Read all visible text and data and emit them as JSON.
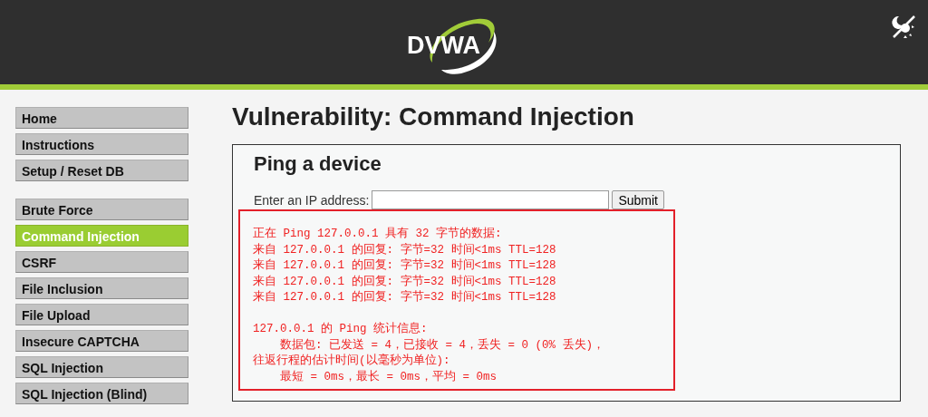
{
  "header": {
    "logo": "DVWA"
  },
  "sidebar": {
    "groups": [
      [
        {
          "label": "Home",
          "selected": false
        },
        {
          "label": "Instructions",
          "selected": false
        },
        {
          "label": "Setup / Reset DB",
          "selected": false
        }
      ],
      [
        {
          "label": "Brute Force",
          "selected": false
        },
        {
          "label": "Command Injection",
          "selected": true
        },
        {
          "label": "CSRF",
          "selected": false
        },
        {
          "label": "File Inclusion",
          "selected": false
        },
        {
          "label": "File Upload",
          "selected": false
        },
        {
          "label": "Insecure CAPTCHA",
          "selected": false
        },
        {
          "label": "SQL Injection",
          "selected": false
        },
        {
          "label": "SQL Injection (Blind)",
          "selected": false
        }
      ]
    ]
  },
  "main": {
    "title": "Vulnerability: Command Injection",
    "panel_title": "Ping a device",
    "form": {
      "label": "Enter an IP address:",
      "button": "Submit"
    },
    "output": [
      [
        "正在 Ping 127.0.0.1 具有 32 字节的数据:",
        "来自 127.0.0.1 的回复: 字节=32 时间<1ms TTL=128",
        "来自 127.0.0.1 的回复: 字节=32 时间<1ms TTL=128",
        "来自 127.0.0.1 的回复: 字节=32 时间<1ms TTL=128",
        "来自 127.0.0.1 的回复: 字节=32 时间<1ms TTL=128"
      ],
      [
        "127.0.0.1 的 Ping 统计信息:",
        "    数据包: 已发送 = 4，已接收 = 4，丢失 = 0 (0% 丢失)，",
        "往返行程的估计时间(以毫秒为单位):",
        "    最短 = 0ms，最长 = 0ms，平均 = 0ms"
      ]
    ]
  }
}
